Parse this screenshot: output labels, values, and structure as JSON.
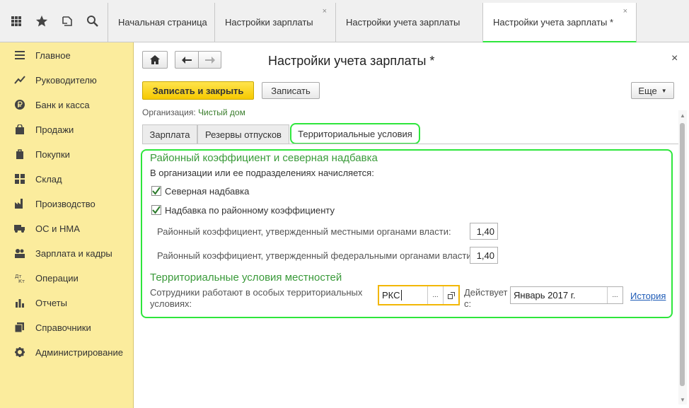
{
  "topbar": {
    "icons": [
      "apps-grid-icon",
      "star-icon",
      "history-icon",
      "search-icon"
    ],
    "tabs": [
      {
        "label": "Начальная страница",
        "closable": false
      },
      {
        "label": "Настройки зарплаты",
        "closable": true
      },
      {
        "label": "Настройки учета зарплаты",
        "closable": false
      },
      {
        "label": "Настройки учета зарплаты *",
        "closable": true,
        "active": true
      }
    ],
    "close_glyph": "×"
  },
  "sidebar": {
    "items": [
      {
        "label": "Главное",
        "icon": "menu-icon"
      },
      {
        "label": "Руководителю",
        "icon": "trend-icon"
      },
      {
        "label": "Банк и касса",
        "icon": "ruble-icon"
      },
      {
        "label": "Продажи",
        "icon": "bag-icon"
      },
      {
        "label": "Покупки",
        "icon": "cart-icon"
      },
      {
        "label": "Склад",
        "icon": "warehouse-icon"
      },
      {
        "label": "Производство",
        "icon": "factory-icon"
      },
      {
        "label": "ОС и НМА",
        "icon": "truck-icon"
      },
      {
        "label": "Зарплата и кадры",
        "icon": "people-icon"
      },
      {
        "label": "Операции",
        "icon": "operations-icon"
      },
      {
        "label": "Отчеты",
        "icon": "bar-chart-icon"
      },
      {
        "label": "Справочники",
        "icon": "book-icon"
      },
      {
        "label": "Администрирование",
        "icon": "gear-icon"
      }
    ]
  },
  "window": {
    "title": "Настройки учета зарплаты *",
    "close": "×"
  },
  "toolbar": {
    "save_close_label": "Записать и закрыть",
    "save_label": "Записать",
    "more_label": "Еще"
  },
  "organization": {
    "label": "Организация:",
    "value": "Чистый дом"
  },
  "form_tabs": [
    {
      "label": "Зарплата"
    },
    {
      "label": "Резервы отпусков"
    },
    {
      "label": "Территориальные условия",
      "active": true
    }
  ],
  "district": {
    "title": "Районный коэффициент и северная надбавка",
    "subtitle": "В организации или ее подразделениях начисляется:",
    "northern_label": "Северная надбавка",
    "northern_checked": true,
    "regional_label": "Надбавка по районному коэффициенту",
    "regional_checked": true,
    "local_coef_label": "Районный коэффициент, утвержденный местными органами власти:",
    "local_coef_value": "1,40",
    "federal_coef_label": "Районный коэффициент, утвержденный федеральными органами власти:",
    "federal_coef_value": "1,40"
  },
  "territorial": {
    "title": "Территориальные условия местностей",
    "employees_label_line1": "Сотрудники работают в особых территориальных",
    "employees_label_line2": "условиях:",
    "condition_value": "РКС",
    "valid_from_label_line1": "Действует",
    "valid_from_label_line2": "с:",
    "valid_from_value": "Январь 2017 г.",
    "history_link": "История",
    "dots": "..."
  },
  "colors": {
    "sidebar_bg": "#fbec9d",
    "primary_button": "#f6c900",
    "highlight_frame": "#2ee63c",
    "section_title": "#3a9a3a",
    "link": "#1e5bb6",
    "input_focus": "#f2b705"
  }
}
